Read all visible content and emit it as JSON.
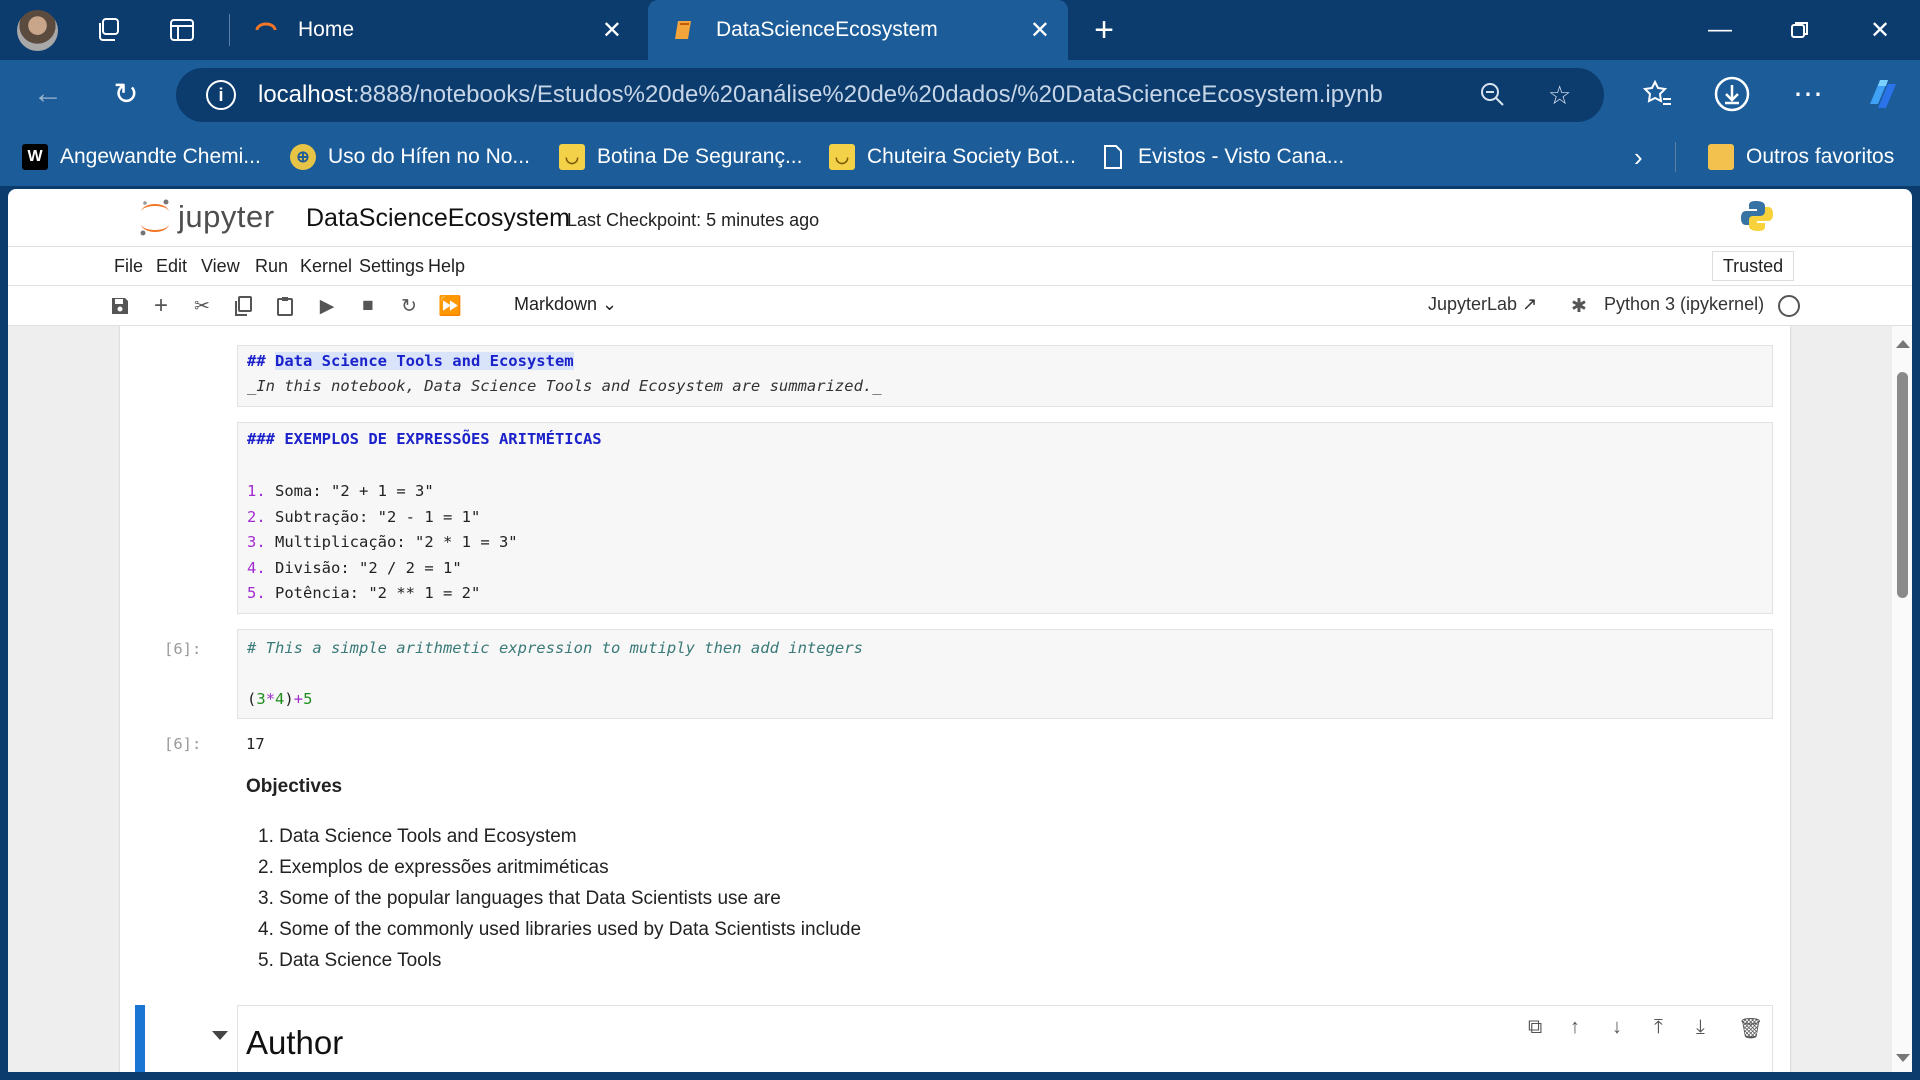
{
  "browser": {
    "tabs": [
      {
        "title": "Home",
        "icon": "jupyter-tab-icon"
      },
      {
        "title": "DataScienceEcosystem",
        "icon": "notebook-tab-icon",
        "active": true
      }
    ],
    "address": {
      "host": "localhost",
      "path": ":8888/notebooks/Estudos%20de%20análise%20de%20dados/%20DataScienceEcosystem.ipynb"
    },
    "bookmarks": [
      {
        "label": "Angewandte Chemi...",
        "icon": "wiley-icon"
      },
      {
        "label": "Uso do Hífen no No...",
        "icon": "site-icon"
      },
      {
        "label": "Botina De Seguranç...",
        "icon": "shop-icon"
      },
      {
        "label": "Chuteira Society Bot...",
        "icon": "shop-icon"
      },
      {
        "label": "Evistos - Visto Cana...",
        "icon": "page-icon"
      }
    ],
    "other_favorites": "Outros favoritos"
  },
  "jupyter": {
    "logo_text": "jupyter",
    "notebook_name": "DataScienceEcosystem",
    "checkpoint": "Last Checkpoint: 5 minutes ago",
    "menu": [
      "File",
      "Edit",
      "View",
      "Run",
      "Kernel",
      "Settings",
      "Help"
    ],
    "trusted": "Trusted",
    "cell_type": "Markdown",
    "jupyterlab_link": "JupyterLab",
    "kernel": "Python 3 (ipykernel)"
  },
  "cells": {
    "md1": {
      "heading_prefix": "## ",
      "heading": "Data Science Tools and Ecosystem",
      "line2": "_In this notebook, Data Science Tools and Ecosystem are summarized._"
    },
    "md2": {
      "heading": "### EXEMPLOS DE EXPRESSÕES ARITMÉTICAS",
      "items": [
        {
          "num": "1.",
          "text": "Soma: \"2 + 1 = 3\""
        },
        {
          "num": "2.",
          "text": "Subtração: \"2 - 1 = 1\""
        },
        {
          "num": "3.",
          "text": "Multiplicação: \"2 * 1 = 3\""
        },
        {
          "num": "4.",
          "text": "Divisão: \"2 / 2 = 1\""
        },
        {
          "num": "5.",
          "text": "Potência: \"2 ** 1 = 2\""
        }
      ]
    },
    "code": {
      "prompt_in": "[6]:",
      "comment": "# This a simple arithmetic expression to mutiply then add integers",
      "code_parts": [
        "(",
        "3",
        "*",
        "4",
        ")",
        "+",
        "5"
      ],
      "prompt_out": "[6]:",
      "output": "17"
    },
    "objectives": {
      "title": "Objectives",
      "items": [
        "1. Data Science Tools and Ecosystem",
        "2. Exemplos de expressões aritmiméticas",
        "3. Some of the popular languages that Data Scientists use are",
        "4. Some of the commonly used libraries used by Data Scientists include",
        "5. Data Science Tools"
      ]
    },
    "author": {
      "heading": "Author"
    }
  },
  "colors": {
    "browser_dark": "#0c3b6e",
    "browser_mid": "#1b5c99",
    "jupyter_orange": "#f37626",
    "active_cell": "#1976d2"
  }
}
